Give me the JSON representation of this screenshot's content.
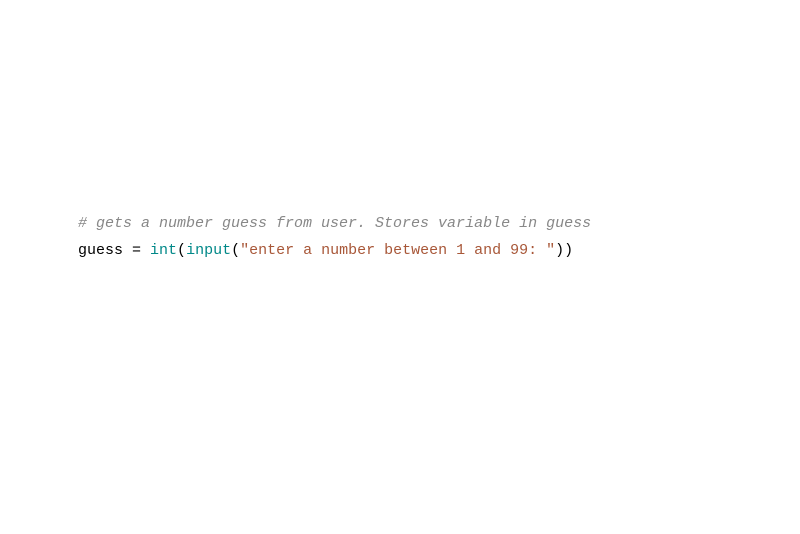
{
  "code": {
    "comment": "# gets a number guess from user. Stores variable in guess",
    "line2": {
      "var": "guess ",
      "eq": "= ",
      "func1": "int",
      "paren1": "(",
      "func2": "input",
      "paren2": "(",
      "str": "\"enter a number between 1 and 99: \"",
      "paren3": "))"
    }
  }
}
